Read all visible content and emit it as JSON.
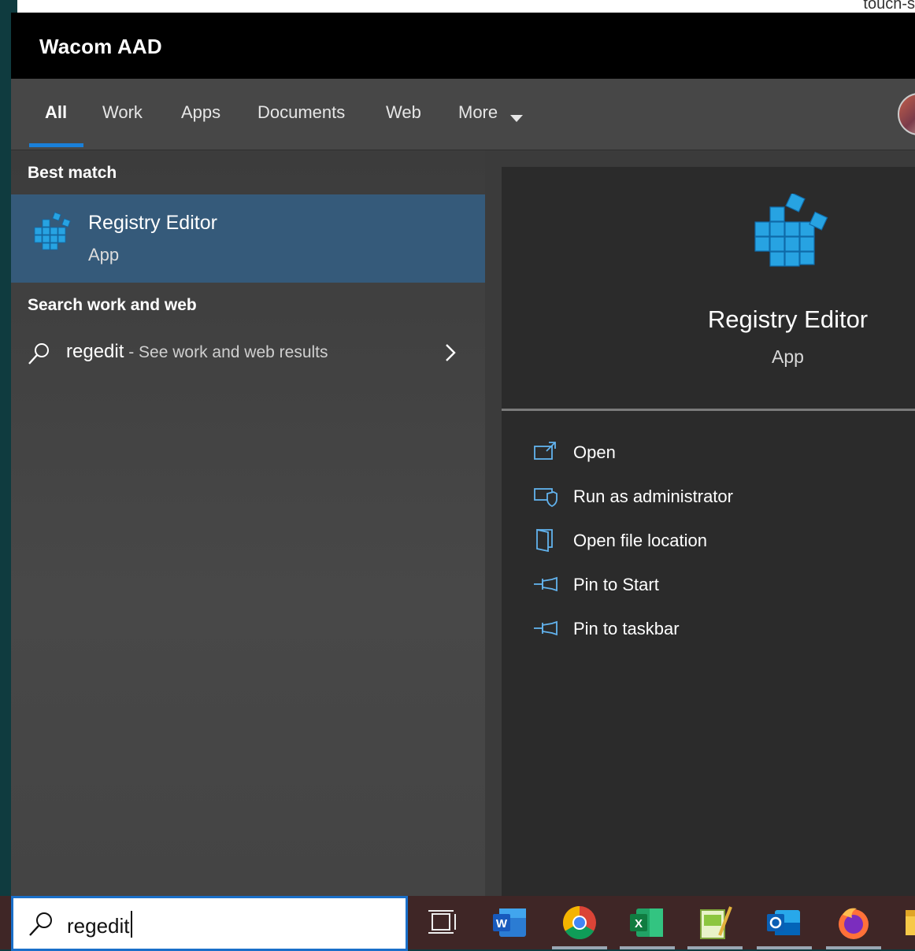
{
  "window": {
    "title": "Wacom AAD",
    "background_window_text": "touch-s"
  },
  "tabs": [
    {
      "label": "All",
      "active": true
    },
    {
      "label": "Work"
    },
    {
      "label": "Apps"
    },
    {
      "label": "Documents"
    },
    {
      "label": "Web"
    },
    {
      "label": "More"
    }
  ],
  "best_match": {
    "section_label": "Best match",
    "title": "Registry Editor",
    "subtitle": "App",
    "icon": "registry-cubes-icon"
  },
  "search_web": {
    "section_label": "Search work and web",
    "query": "regedit",
    "hint": " - See work and web results"
  },
  "preview": {
    "title": "Registry Editor",
    "subtitle": "App",
    "actions": [
      {
        "label": "Open",
        "icon": "open-icon"
      },
      {
        "label": "Run as administrator",
        "icon": "shield-icon"
      },
      {
        "label": "Open file location",
        "icon": "folder-icon"
      },
      {
        "label": "Pin to Start",
        "icon": "pin-icon"
      },
      {
        "label": "Pin to taskbar",
        "icon": "pin-icon"
      }
    ]
  },
  "taskbar": {
    "search_value": "regedit",
    "apps": [
      "task-view",
      "word",
      "chrome",
      "excel",
      "notepad",
      "outlook",
      "firefox",
      "file-explorer"
    ]
  },
  "colors": {
    "accent": "#1a80d9",
    "selected_row": "#355a7a",
    "header": "#000000"
  }
}
